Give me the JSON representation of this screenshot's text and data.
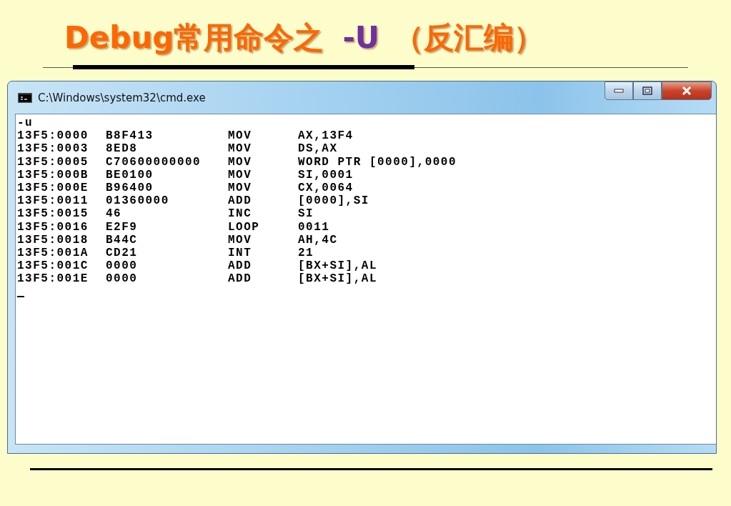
{
  "slide": {
    "title": {
      "before": "Debug常用命令之",
      "command": "-U",
      "after": "（反汇编）"
    }
  },
  "window": {
    "title": "C:\\Windows\\system32\\cmd.exe"
  },
  "console": {
    "prompt": "-u",
    "rows": [
      {
        "address": "13F5:0000",
        "bytes": "B8F413",
        "mnemonic": "MOV",
        "operands": "AX,13F4"
      },
      {
        "address": "13F5:0003",
        "bytes": "8ED8",
        "mnemonic": "MOV",
        "operands": "DS,AX"
      },
      {
        "address": "13F5:0005",
        "bytes": "C70600000000",
        "mnemonic": "MOV",
        "operands": "WORD PTR [0000],0000"
      },
      {
        "address": "13F5:000B",
        "bytes": "BE0100",
        "mnemonic": "MOV",
        "operands": "SI,0001"
      },
      {
        "address": "13F5:000E",
        "bytes": "B96400",
        "mnemonic": "MOV",
        "operands": "CX,0064"
      },
      {
        "address": "13F5:0011",
        "bytes": "01360000",
        "mnemonic": "ADD",
        "operands": "[0000],SI"
      },
      {
        "address": "13F5:0015",
        "bytes": "46",
        "mnemonic": "INC",
        "operands": "SI"
      },
      {
        "address": "13F5:0016",
        "bytes": "E2F9",
        "mnemonic": "LOOP",
        "operands": "0011"
      },
      {
        "address": "13F5:0018",
        "bytes": "B44C",
        "mnemonic": "MOV",
        "operands": "AH,4C"
      },
      {
        "address": "13F5:001A",
        "bytes": "CD21",
        "mnemonic": "INT",
        "operands": "21"
      },
      {
        "address": "13F5:001C",
        "bytes": "0000",
        "mnemonic": "ADD",
        "operands": "[BX+SI],AL"
      },
      {
        "address": "13F5:001E",
        "bytes": "0000",
        "mnemonic": "ADD",
        "operands": "[BX+SI],AL"
      }
    ]
  }
}
